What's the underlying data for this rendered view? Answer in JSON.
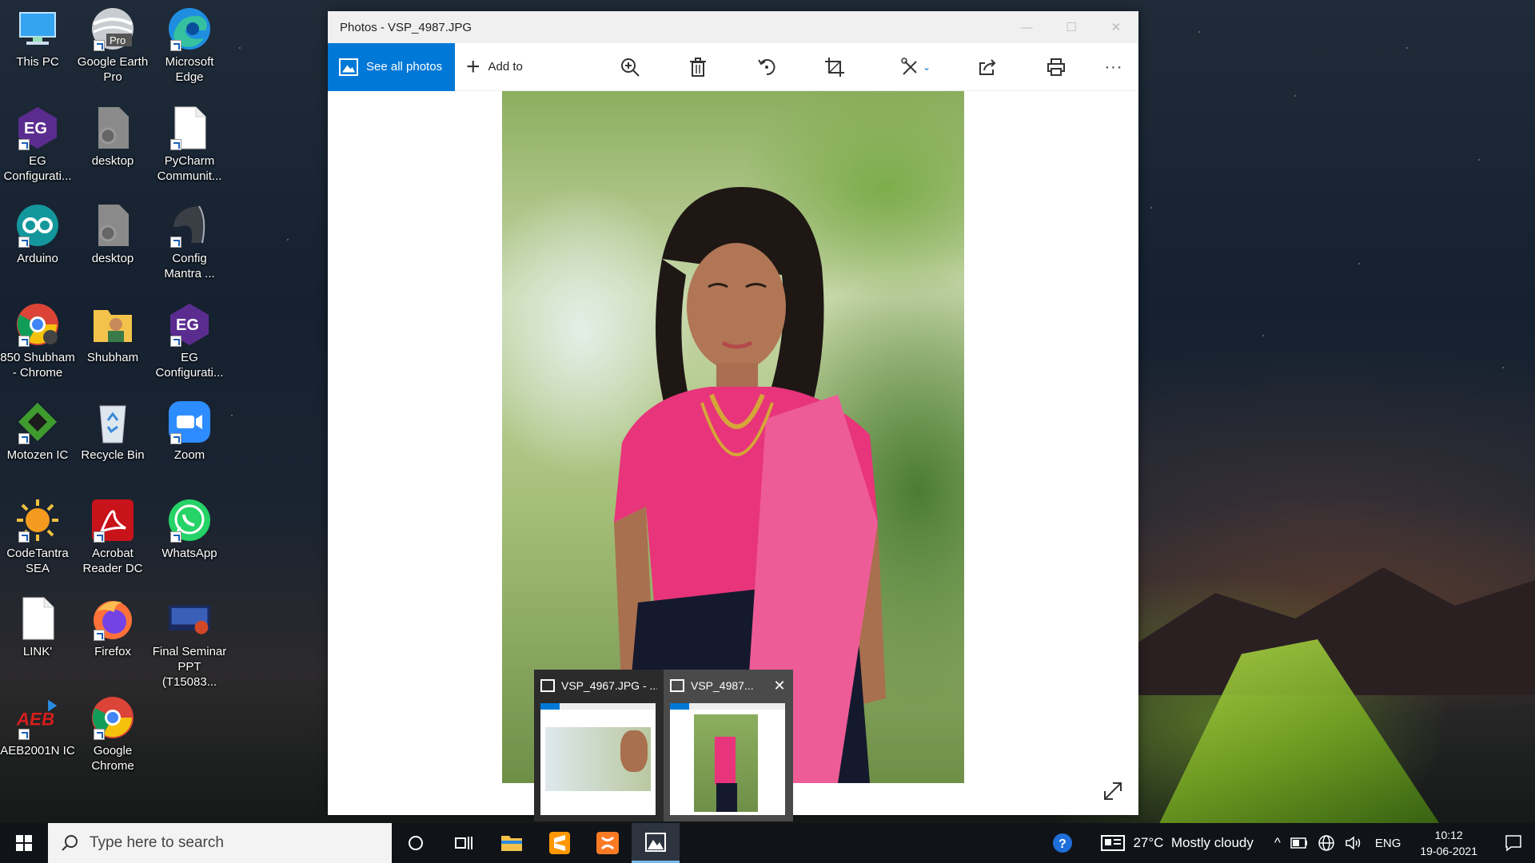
{
  "desktop": {
    "icons": [
      {
        "label": "This PC"
      },
      {
        "label": "Google Earth Pro"
      },
      {
        "label": "Microsoft Edge"
      },
      {
        "label": "EG Configurati..."
      },
      {
        "label": "desktop"
      },
      {
        "label": "PyCharm Communit..."
      },
      {
        "label": "Arduino"
      },
      {
        "label": "desktop"
      },
      {
        "label": "Config Mantra ..."
      },
      {
        "label": "850 Shubham - Chrome"
      },
      {
        "label": "Shubham"
      },
      {
        "label": "EG Configurati..."
      },
      {
        "label": "Motozen IC"
      },
      {
        "label": "Recycle Bin"
      },
      {
        "label": "Zoom"
      },
      {
        "label": "CodeTantra SEA"
      },
      {
        "label": "Acrobat Reader DC"
      },
      {
        "label": "WhatsApp"
      },
      {
        "label": "LINK'"
      },
      {
        "label": "Firefox"
      },
      {
        "label": "Final Seminar PPT (T15083..."
      },
      {
        "label": "AEB2001N IC"
      },
      {
        "label": "Google Chrome"
      }
    ],
    "earth_badge": "Pro",
    "eg_badge": "EG",
    "aeb_badge": "AEB"
  },
  "window": {
    "title": "Photos - VSP_4987.JPG",
    "see_all": "See all photos",
    "add_to": "Add to"
  },
  "thumbnails": [
    {
      "title": "VSP_4967.JPG - ..."
    },
    {
      "title": "VSP_4987..."
    }
  ],
  "taskbar": {
    "search_placeholder": "Type here to search",
    "weather": "27°C  Mostly cloudy",
    "language": "ENG",
    "time": "10:12",
    "date": "19-06-2021"
  },
  "colors": {
    "accent": "#0078d7",
    "taskbar": "#101318"
  }
}
